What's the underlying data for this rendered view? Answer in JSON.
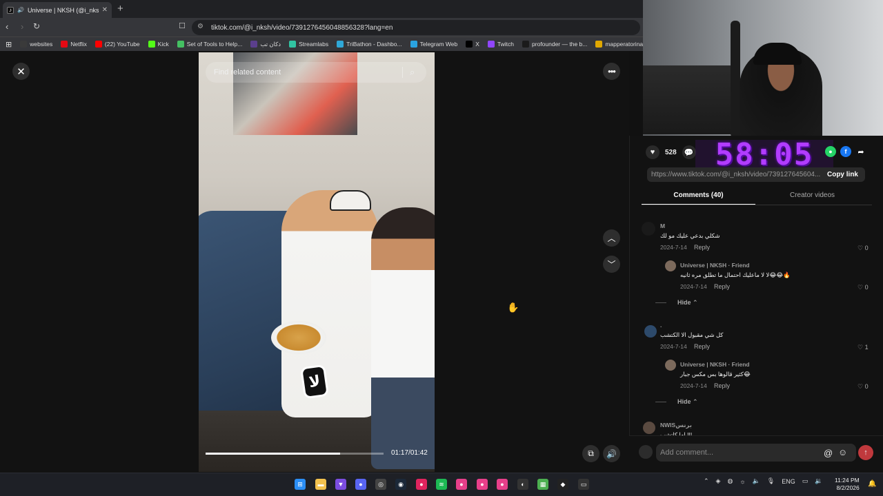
{
  "browser": {
    "tab_title": "Universe | NKSH (@i_nksh) | T",
    "tab_close": "✕",
    "new_tab": "+",
    "url": "tiktok.com/@i_nksh/video/7391276456048856328?lang=en",
    "bookmarks": [
      {
        "label": "websites",
        "icon": "folder-icon",
        "color": "#3a3a3a"
      },
      {
        "label": "Netflix",
        "icon": "netflix-icon",
        "color": "#e50914"
      },
      {
        "label": "(22) YouTube",
        "icon": "youtube-icon",
        "color": "#ff0000"
      },
      {
        "label": "Kick",
        "icon": "kick-icon",
        "color": "#53fc18"
      },
      {
        "label": "Set of Tools to Help...",
        "icon": "tools-icon",
        "color": "#44c062"
      },
      {
        "label": "دكان تب",
        "icon": "shop-icon",
        "color": "#5b3f8c"
      },
      {
        "label": "Streamlabs",
        "icon": "streamlabs-icon",
        "color": "#31c3a2"
      },
      {
        "label": "TriBathon - Dashbo...",
        "icon": "tribathon-icon",
        "color": "#2fa8d8"
      },
      {
        "label": "Telegram Web",
        "icon": "telegram-icon",
        "color": "#2aa3e0"
      },
      {
        "label": "X",
        "icon": "x-icon",
        "color": "#000000"
      },
      {
        "label": "Twitch",
        "icon": "twitch-icon",
        "color": "#9146ff"
      },
      {
        "label": "profounder — the b...",
        "icon": "profounder-icon",
        "color": "#1b1b1b"
      },
      {
        "label": "mapperatorinator_i...",
        "icon": "mapper-icon",
        "color": "#e0a800"
      }
    ]
  },
  "video": {
    "search_placeholder": "Find related content",
    "elapsed": "01:17",
    "duration": "01:42",
    "progress": 0.755,
    "badge_text": "لا"
  },
  "engagement": {
    "likes": "528",
    "timer": "58:05",
    "link": "https://www.tiktok.com/@i_nksh/video/739127645604...",
    "copy_link": "Copy link"
  },
  "tabs": {
    "comments": "Comments (40)",
    "creator": "Creator videos"
  },
  "comments": [
    {
      "name": "M",
      "text": "شكلي بدعي عليك مو لك",
      "date": "2024-7-14",
      "reply": "Reply",
      "likes": "0"
    },
    {
      "name": "Universe | NKSH · Friend",
      "text": "لا لا ماعليك احتمال ما تطلق مره ثانيه😂😂🔥",
      "date": "2024-7-14",
      "reply": "Reply",
      "likes": "0"
    },
    {
      "hide": "Hide"
    },
    {
      "name": ".",
      "text": "كل شي مقبول الا الكتشب",
      "date": "2024-7-14",
      "reply": "Reply",
      "likes": "1"
    },
    {
      "name": "Universe | NKSH · Friend",
      "text": "كثير قالوها بس مكس جبار😂",
      "date": "2024-7-14",
      "reply": "Reply",
      "likes": "0"
    },
    {
      "hide": "Hide"
    },
    {
      "name": "NWISبرنس",
      "text": "اما كاتشب !!!"
    }
  ],
  "comment_box": {
    "placeholder": "Add comment..."
  },
  "taskbar": {
    "language": "ENG",
    "time": "11:24 PM",
    "date": "8/2/2026"
  },
  "colors": {
    "accent_red": "#fe2c55",
    "timer_purple": "#b23cff"
  }
}
